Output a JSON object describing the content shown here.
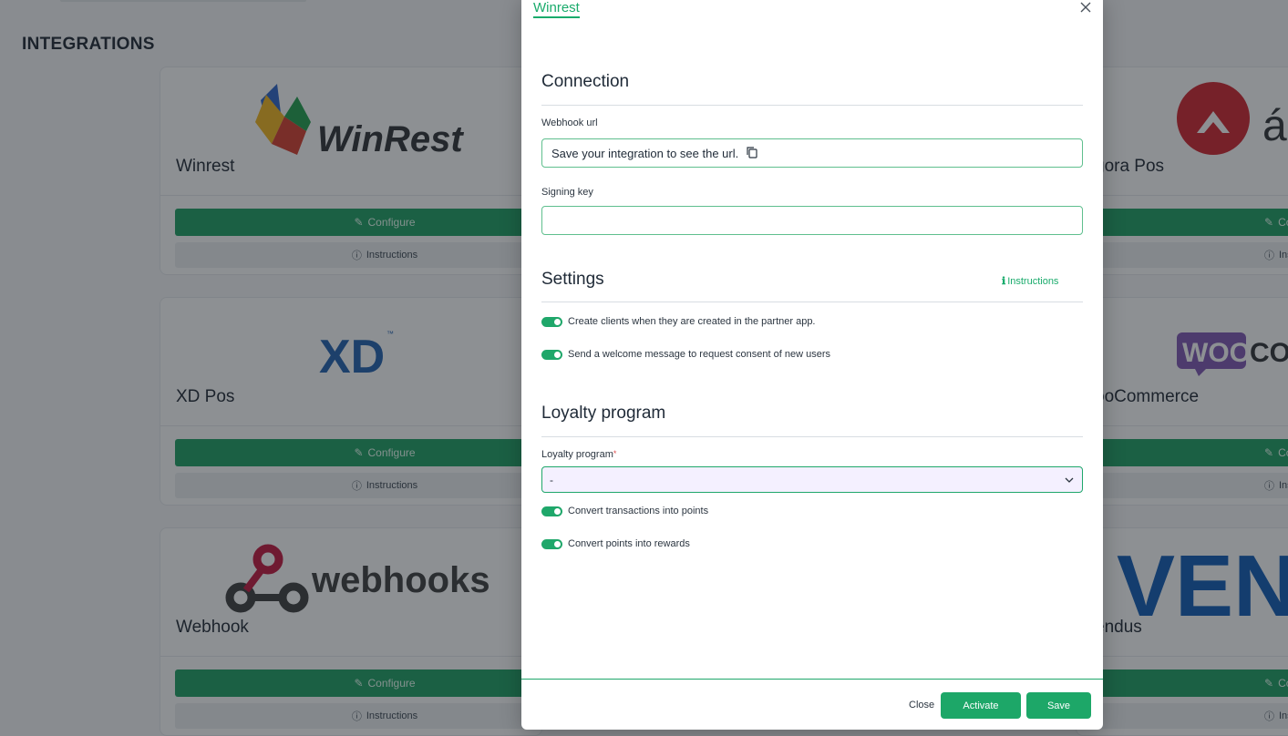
{
  "page": {
    "title": "INTEGRATIONS"
  },
  "integrations_left": [
    {
      "name": "Winrest",
      "logo_text": "WinRest",
      "configure_label": "Configure",
      "instructions_label": "Instructions"
    },
    {
      "name": "XD Pos",
      "logo_text": "XD",
      "configure_label": "Configure",
      "instructions_label": "Instructions"
    },
    {
      "name": "Webhook",
      "logo_text": "webhooks",
      "configure_label": "Configure",
      "instructions_label": "Instructions"
    }
  ],
  "integrations_right": [
    {
      "name": "gora Pos",
      "logo_text": "á",
      "configure_label": "Co",
      "instructions_label": "Ins"
    },
    {
      "name": "ooCommerce",
      "logo_text": "COM",
      "configure_label": "Co",
      "instructions_label": "Ins"
    },
    {
      "name": "endus",
      "logo_text": "VEND",
      "configure_label": "Co",
      "instructions_label": "Ins"
    }
  ],
  "modal": {
    "tab_label": "Winrest",
    "connection": {
      "title": "Connection",
      "webhook_label": "Webhook url",
      "webhook_value": "Save your integration to see the url.",
      "signing_label": "Signing key",
      "signing_value": ""
    },
    "settings": {
      "title": "Settings",
      "instructions_label": "Instructions",
      "toggles": [
        {
          "label": "Create clients when they are created in the partner app.",
          "on": true
        },
        {
          "label": "Send a welcome message to request consent of new users",
          "on": true
        }
      ]
    },
    "loyalty": {
      "title": "Loyalty program",
      "select_label": "Loyalty program",
      "required_mark": "*",
      "selected": "-",
      "toggles": [
        {
          "label": "Convert transactions into points",
          "on": true
        },
        {
          "label": "Convert points into rewards",
          "on": true
        }
      ]
    },
    "footer": {
      "close_label": "Close",
      "activate_label": "Activate",
      "save_label": "Save"
    }
  },
  "colors": {
    "accent": "#1aab6c",
    "button_green": "#1da768",
    "select_bg": "#f4f0ff",
    "overlay": "rgba(28,34,40,0.5)"
  }
}
